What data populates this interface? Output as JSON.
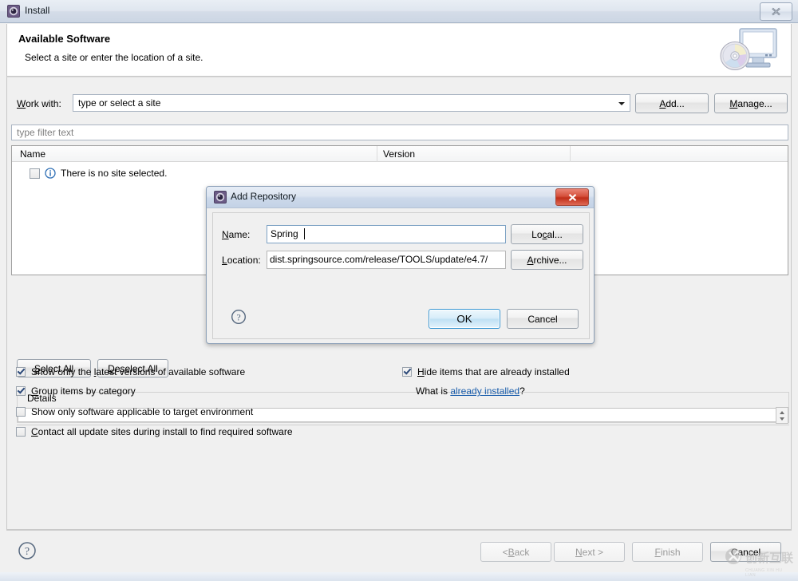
{
  "window": {
    "title": "Install",
    "icon": "eclipse-install-icon",
    "close_label": "x"
  },
  "header": {
    "title": "Available Software",
    "subtitle": "Select a site or enter the location of a site.",
    "graphic": "monitor-cd-icon"
  },
  "work_with": {
    "label": "Work with:",
    "label_mnemonic": "W",
    "label_rest": "ork with:",
    "combo_value": "type or select a site",
    "add_button": "Add...",
    "add_mnemonic": "A",
    "add_rest": "dd...",
    "manage_button": "Manage...",
    "manage_mnemonic": "M",
    "manage_rest": "anage..."
  },
  "filter": {
    "placeholder": "type filter text"
  },
  "table": {
    "columns": [
      "Name",
      "Version"
    ],
    "rows": [
      {
        "checked": false,
        "icon": "info-icon",
        "name": "There is no site selected.",
        "version": ""
      }
    ]
  },
  "list_actions": {
    "select_all": "Select All",
    "select_all_mnemonic": "S",
    "select_all_rest": "elect All",
    "deselect_all": "Deselect All",
    "deselect_all_mnemonic": "D",
    "deselect_all_rest": "eselect All"
  },
  "details": {
    "group_label": "Details",
    "value": ""
  },
  "options": {
    "left": [
      {
        "label_pre": "Show only the ",
        "mnemonic": "l",
        "label_post": "atest versions of available software",
        "checked": true
      },
      {
        "label_pre": "",
        "mnemonic": "G",
        "label_post": "roup items by category",
        "checked": true
      },
      {
        "label_pre": "Show only software applicable to target environment",
        "mnemonic": "",
        "label_post": "",
        "checked": false
      },
      {
        "label_pre": "",
        "mnemonic": "C",
        "label_post": "ontact all update sites during install to find required software",
        "checked": false
      }
    ],
    "right": [
      {
        "label_pre": "",
        "mnemonic": "H",
        "label_post": "ide items that are already installed",
        "checked": true
      }
    ],
    "what_is_prefix": "What is ",
    "what_is_link": "already installed",
    "what_is_suffix": "?"
  },
  "wizard_buttons": {
    "back": "< Back",
    "back_mnemonic": "B",
    "back_pre": "< ",
    "back_post": "ack",
    "next": "Next >",
    "next_mnemonic": "N",
    "next_pre": "",
    "next_post": "ext >",
    "finish": "Finish",
    "finish_mnemonic": "F",
    "finish_post": "inish",
    "cancel": "Cancel",
    "help": "help-icon"
  },
  "modal": {
    "title": "Add Repository",
    "icon": "eclipse-install-icon",
    "close_label": "x",
    "name_label": "Name:",
    "name_mnemonic": "N",
    "name_label_rest": "ame:",
    "name_value": "Spring",
    "location_label": "Location:",
    "location_mnemonic": "L",
    "location_label_rest": "ocation:",
    "location_value": "dist.springsource.com/release/TOOLS/update/e4.7/",
    "local_button": "Local...",
    "local_mnemonic": "c",
    "local_pre": "Lo",
    "local_post": "al...",
    "archive_button": "Archive...",
    "archive_mnemonic": "A",
    "archive_post": "rchive...",
    "ok_button": "OK",
    "cancel_button": "Cancel",
    "help": "help-icon"
  },
  "watermark": {
    "chinese": "创新互联",
    "pinyin": "CHUANG XIN HU LIAN",
    "logo": "circled-x-logo"
  },
  "colors": {
    "accent_blue": "#3c98d3",
    "link_blue": "#1a5dab",
    "close_red": "#bf2e19",
    "titlebar_blue": "#ccd6e4"
  }
}
